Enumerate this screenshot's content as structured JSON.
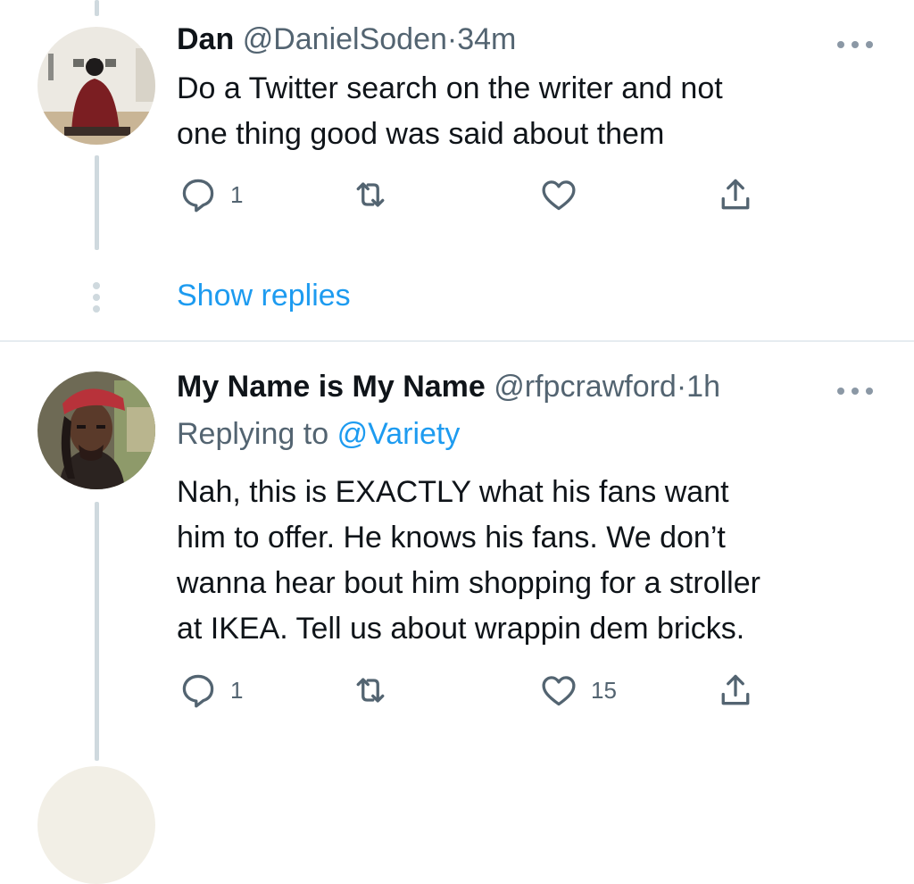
{
  "tweets": [
    {
      "display_name": "Dan",
      "handle": "@DanielSoden",
      "separator": "·",
      "time": "34m",
      "text": "Do a Twitter search on the writer and not\none thing good was said about them",
      "reply_count": "1",
      "like_count": "",
      "more_icon": "more-horizontal-icon"
    },
    {
      "display_name": "My Name is My Name",
      "handle": "@rfpcrawford",
      "separator": "·",
      "time": "1h",
      "replying_prefix": "Replying to",
      "replying_to": "@Variety",
      "text": "Nah, this is EXACTLY what his fans want\nhim to offer. He knows his fans. We don’t\nwanna hear bout him shopping for a stroller\nat IKEA. Tell us  about wrappin dem bricks.",
      "reply_count": "1",
      "like_count": "15",
      "more_icon": "more-horizontal-icon"
    }
  ],
  "show_replies_label": "Show replies",
  "colors": {
    "link": "#1d9bf0",
    "secondary_text": "#536471",
    "icon": "#536471",
    "thread_line": "#cfd9de"
  }
}
